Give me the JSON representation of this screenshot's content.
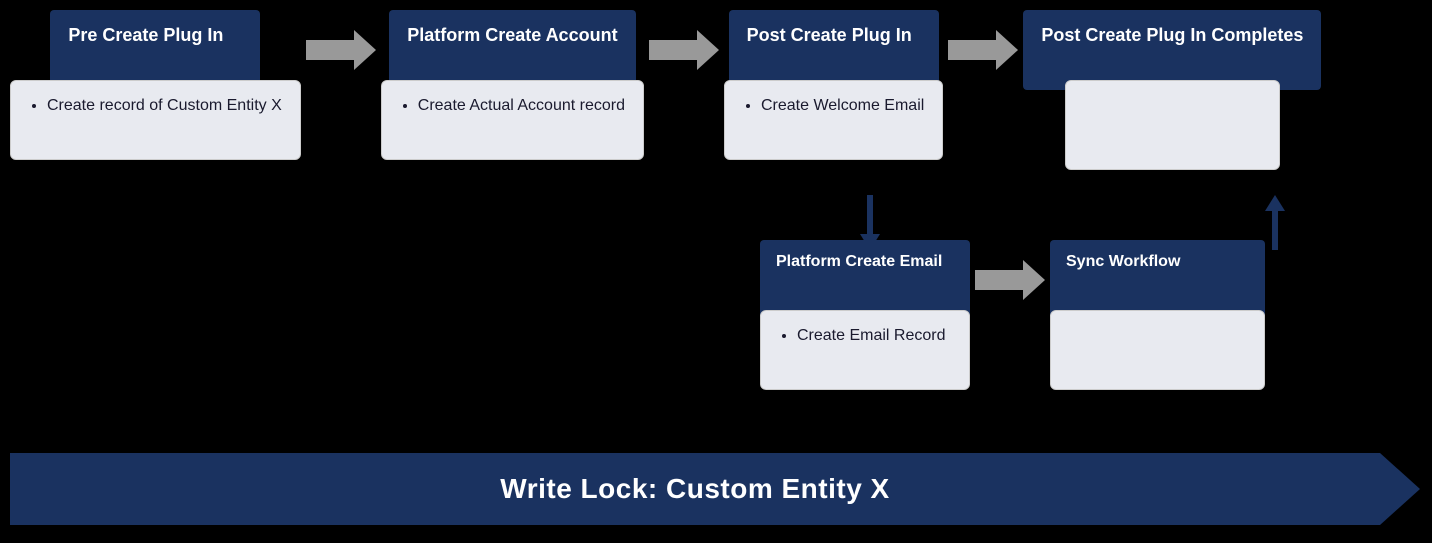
{
  "diagram": {
    "background": "#000000",
    "accent_color": "#1a3260",
    "top_row": [
      {
        "id": "pre-create",
        "blue_label": "Pre Create Plug In",
        "white_items": [
          "Create record of Custom Entity X"
        ]
      },
      {
        "id": "platform-account",
        "blue_label": "Platform Create Account",
        "white_items": [
          "Create Actual Account record"
        ]
      },
      {
        "id": "post-create",
        "blue_label": "Post Create Plug In",
        "white_items": [
          "Create Welcome Email"
        ]
      },
      {
        "id": "post-completes",
        "blue_label": "Post Create Plug In Completes",
        "white_items": []
      }
    ],
    "bottom_row": [
      {
        "id": "platform-email",
        "blue_label": "Platform Create Email",
        "white_items": [
          "Create Email Record"
        ]
      },
      {
        "id": "sync-workflow",
        "blue_label": "Sync Workflow",
        "white_items": []
      }
    ],
    "write_lock_label": "Write Lock: Custom Entity X"
  }
}
